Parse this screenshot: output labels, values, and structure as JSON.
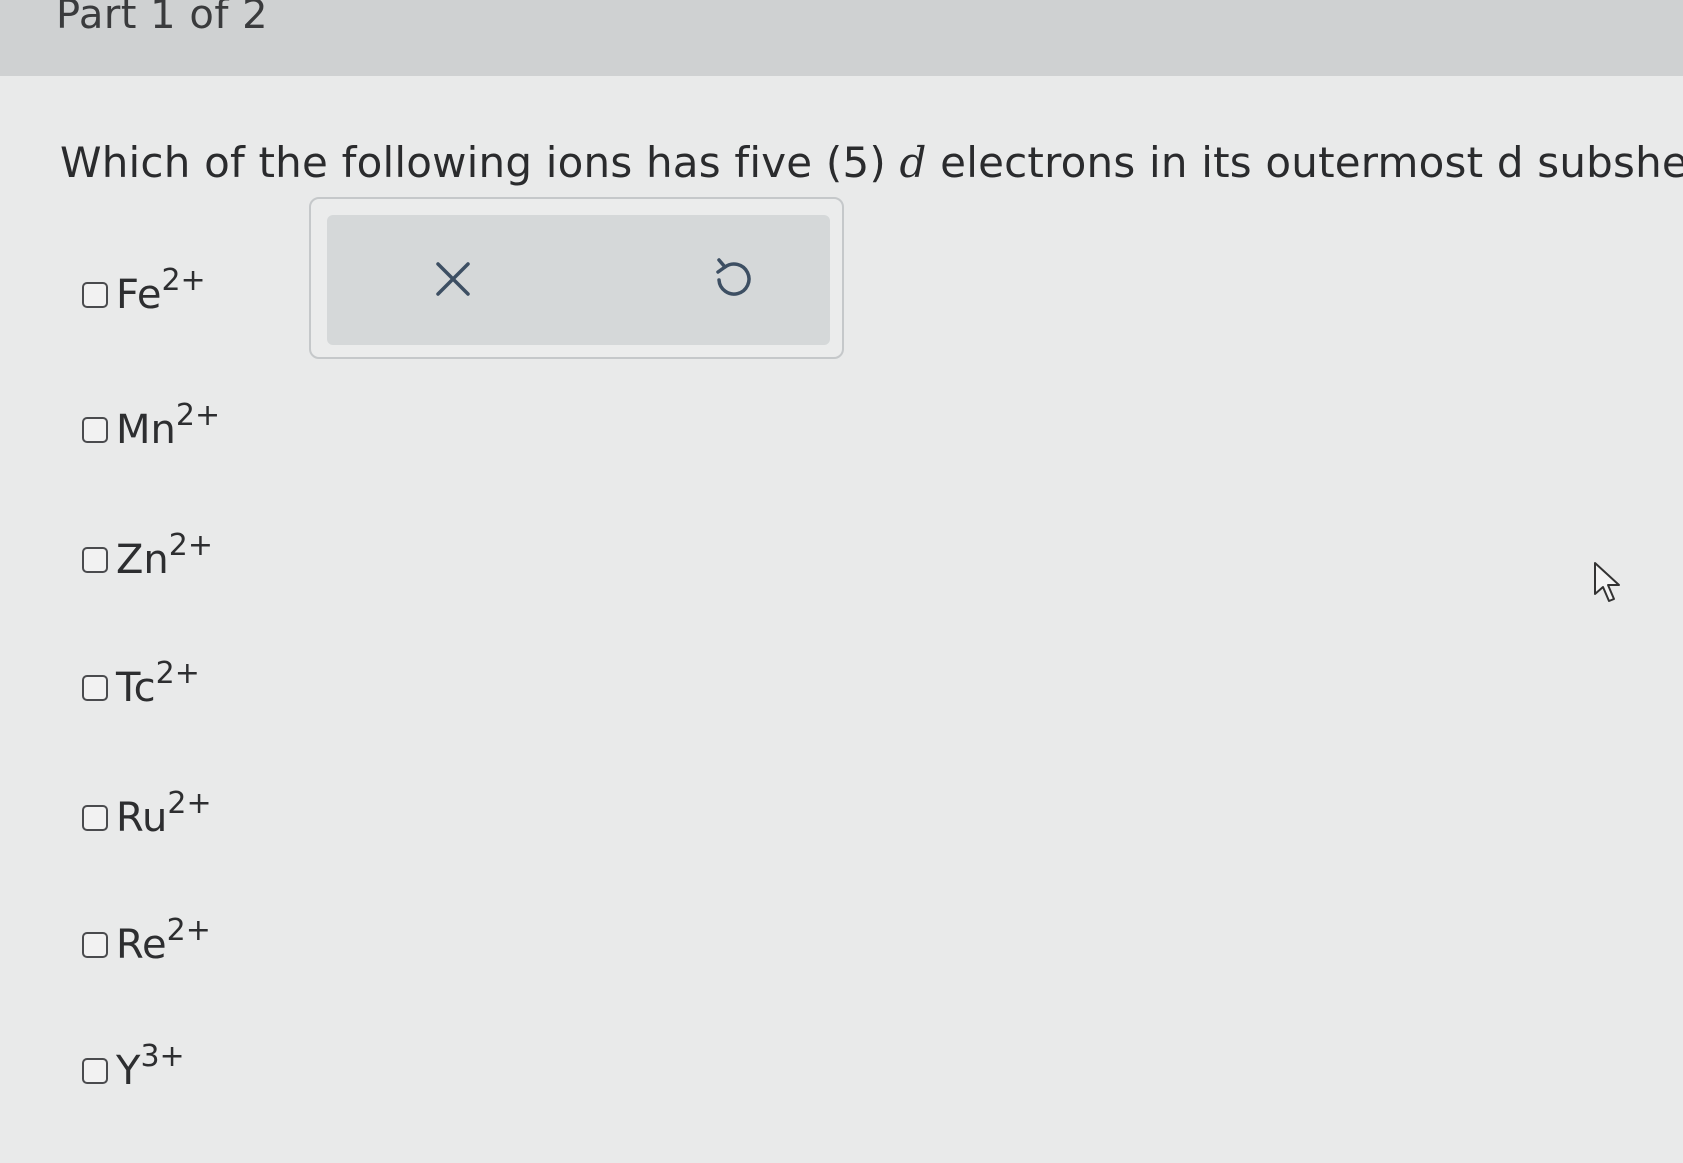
{
  "header": {
    "part_label": "Part 1 of 2"
  },
  "question": {
    "text_before": "Which of the following ions has five (5) ",
    "italic_letter": "d",
    "text_after": " electrons in its outermost d subshell"
  },
  "toolbox": {
    "clear_icon": "close-icon",
    "undo_icon": "undo-icon"
  },
  "options": [
    {
      "symbol": "Fe",
      "charge": "2+"
    },
    {
      "symbol": "Mn",
      "charge": "2+"
    },
    {
      "symbol": "Zn",
      "charge": "2+"
    },
    {
      "symbol": "Tc",
      "charge": "2+"
    },
    {
      "symbol": "Ru",
      "charge": "2+"
    },
    {
      "symbol": "Re",
      "charge": "2+"
    },
    {
      "symbol": "Y",
      "charge": "3+"
    }
  ],
  "colors": {
    "background": "#e9eaea",
    "header_background": "#cfd1d2",
    "toolbox_background": "#d5d8d9",
    "text": "#2b2b2d"
  }
}
